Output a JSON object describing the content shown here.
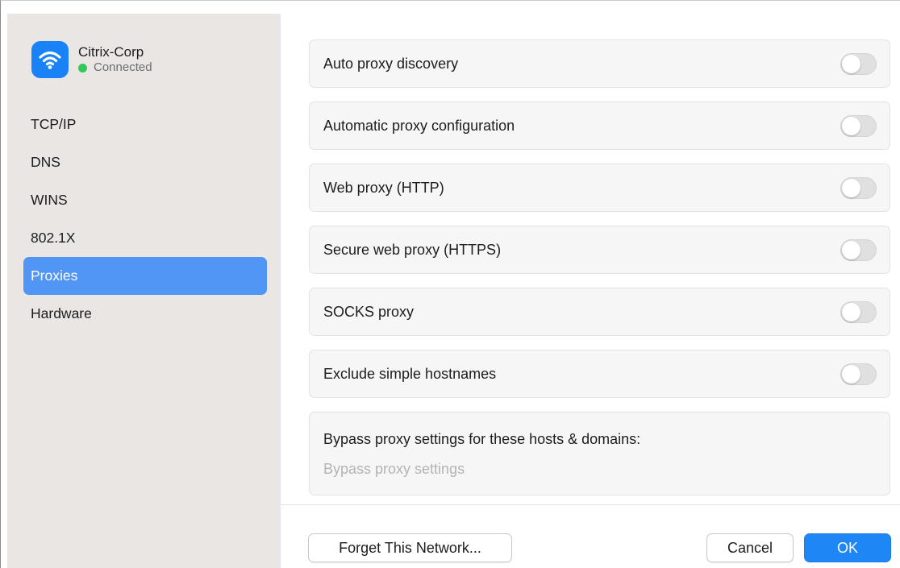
{
  "network": {
    "name": "Citrix-Corp",
    "status": "Connected",
    "icon": "wifi-icon",
    "status_color": "#34c759"
  },
  "sidebar": {
    "items": [
      {
        "label": "TCP/IP",
        "active": false
      },
      {
        "label": "DNS",
        "active": false
      },
      {
        "label": "WINS",
        "active": false
      },
      {
        "label": "802.1X",
        "active": false
      },
      {
        "label": "Proxies",
        "active": true
      },
      {
        "label": "Hardware",
        "active": false
      }
    ]
  },
  "proxies": {
    "rows": [
      {
        "label": "Auto proxy discovery",
        "enabled": false
      },
      {
        "label": "Automatic proxy configuration",
        "enabled": false
      },
      {
        "label": "Web proxy (HTTP)",
        "enabled": false
      },
      {
        "label": "Secure web proxy (HTTPS)",
        "enabled": false
      },
      {
        "label": "SOCKS proxy",
        "enabled": false
      },
      {
        "label": "Exclude simple hostnames",
        "enabled": false
      }
    ],
    "bypass_label": "Bypass proxy settings for these hosts & domains:",
    "bypass_value": "",
    "bypass_placeholder": "Bypass proxy settings"
  },
  "footer": {
    "forget_label": "Forget This Network...",
    "cancel_label": "Cancel",
    "ok_label": "OK"
  },
  "colors": {
    "accent": "#1f86f5",
    "sidebar_active": "#5196f5",
    "sidebar_bg": "#e9e6e3"
  }
}
